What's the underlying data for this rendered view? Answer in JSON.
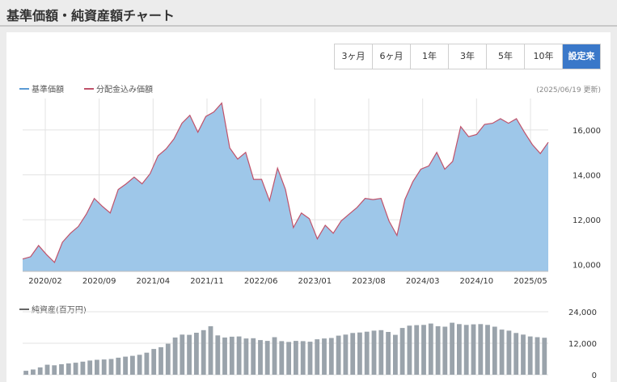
{
  "header": {
    "title": "基準価額・純資産額チャート"
  },
  "tabs": [
    "3ヶ月",
    "6ヶ月",
    "1年",
    "3年",
    "5年",
    "10年",
    "設定来"
  ],
  "active_tab": 6,
  "colors": {
    "nav_line": "#c0526a",
    "nav_fill": "#9ec7e9",
    "legend_blue": "#5b9bd5",
    "bar": "#9aa3ab",
    "active_tab": "#3a78c9"
  },
  "updated": "(2025/06/19 更新)",
  "chart_data": [
    {
      "type": "area",
      "legend": [
        "基準価額",
        "分配金込み価額"
      ],
      "x_ticks": [
        "2020/02",
        "2020/09",
        "2021/04",
        "2021/11",
        "2022/06",
        "2023/01",
        "2023/08",
        "2024/03",
        "2024/10",
        "2025/05"
      ],
      "y_ticks": [
        "16,000",
        "14,000",
        "12,000",
        "10,000"
      ],
      "ylim": [
        9700,
        17400
      ],
      "y_tick_values": [
        16000,
        14000,
        12000,
        10000
      ],
      "values": [
        10250,
        10350,
        10850,
        10450,
        10100,
        11000,
        11400,
        11700,
        12250,
        12950,
        12600,
        12300,
        13350,
        13600,
        13900,
        13600,
        14050,
        14850,
        15150,
        15600,
        16300,
        16650,
        15900,
        16600,
        16800,
        17200,
        15200,
        14700,
        15000,
        13800,
        13800,
        12850,
        14300,
        13350,
        11650,
        12300,
        12050,
        11150,
        11750,
        11400,
        11950,
        12250,
        12550,
        12950,
        12900,
        12950,
        11950,
        11300,
        12900,
        13700,
        14250,
        14400,
        15000,
        14250,
        14600,
        16150,
        15700,
        15800,
        16250,
        16300,
        16500,
        16300,
        16500,
        15900,
        15350,
        14950,
        15450
      ]
    },
    {
      "type": "bar",
      "legend": [
        "純資産(百万円)"
      ],
      "y_ticks": [
        "24,000",
        "12,000",
        "0"
      ],
      "ylim": [
        0,
        24000
      ],
      "y_tick_values": [
        24000,
        12000,
        0
      ],
      "values": [
        1500,
        2000,
        2800,
        3800,
        3600,
        4000,
        4300,
        4600,
        5000,
        5400,
        5700,
        5800,
        6000,
        6500,
        6900,
        7200,
        7600,
        8400,
        9800,
        10500,
        11800,
        14200,
        15300,
        15200,
        16000,
        17000,
        18500,
        15000,
        14200,
        14500,
        14600,
        13800,
        13900,
        13200,
        12900,
        14300,
        12800,
        12500,
        12900,
        12800,
        12600,
        13500,
        13800,
        14000,
        14900,
        15300,
        15900,
        16100,
        16400,
        16800,
        17000,
        16300,
        15200,
        17800,
        18700,
        18900,
        19000,
        19500,
        18500,
        18300,
        19800,
        19300,
        19000,
        19200,
        19300,
        19000,
        18300,
        17200,
        16800,
        15900,
        15300,
        14600,
        14300,
        14100
      ]
    }
  ]
}
